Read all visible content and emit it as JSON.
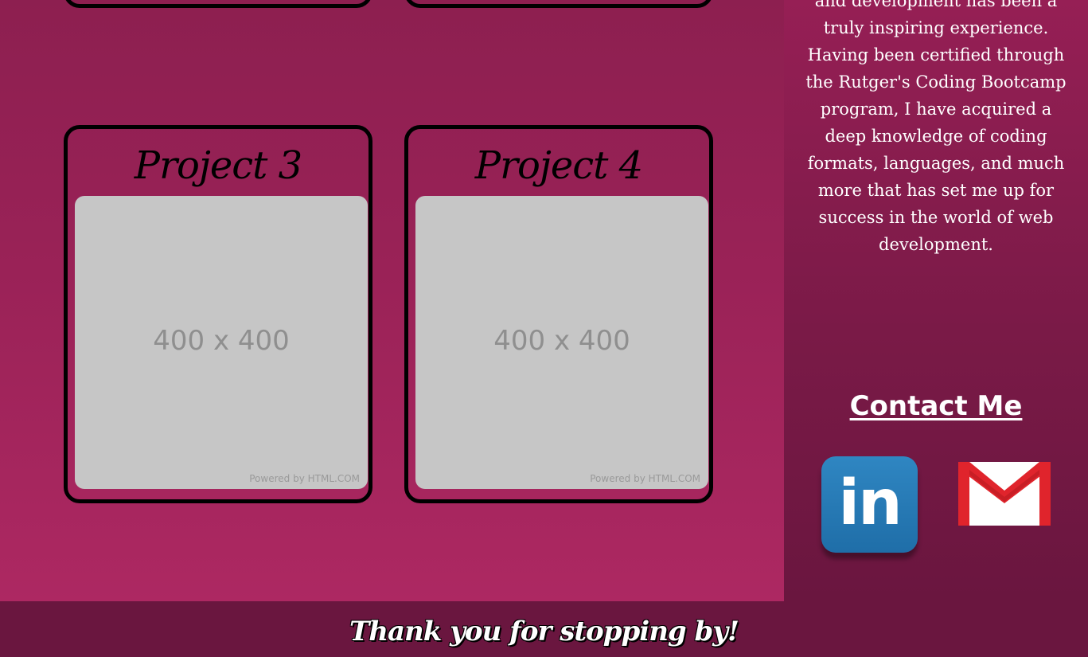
{
  "projects": [
    {
      "title": "Project 3",
      "placeholder_size": "400 x 400",
      "placeholder_credit": "Powered by HTML.COM"
    },
    {
      "title": "Project 4",
      "placeholder_size": "400 x 400",
      "placeholder_credit": "Powered by HTML.COM"
    }
  ],
  "about": {
    "text": "and development has been a truly inspiring experience. Having been certified through the Rutger's Coding Bootcamp program, I have acquired a deep knowledge of coding formats, languages, and much more that has set me up for success in the world of web development."
  },
  "contact": {
    "heading": "Contact Me",
    "links": [
      {
        "icon": "linkedin-icon",
        "label": "in"
      },
      {
        "icon": "gmail-icon"
      }
    ]
  },
  "footer": {
    "text": "Thank you for stopping by!"
  },
  "colors": {
    "main_bg": "#9a2257",
    "aside_bg": "#7a1a47",
    "footer_bg": "#6a163f",
    "linkedin_blue": "#2275b0",
    "gmail_red": "#e0242c"
  }
}
